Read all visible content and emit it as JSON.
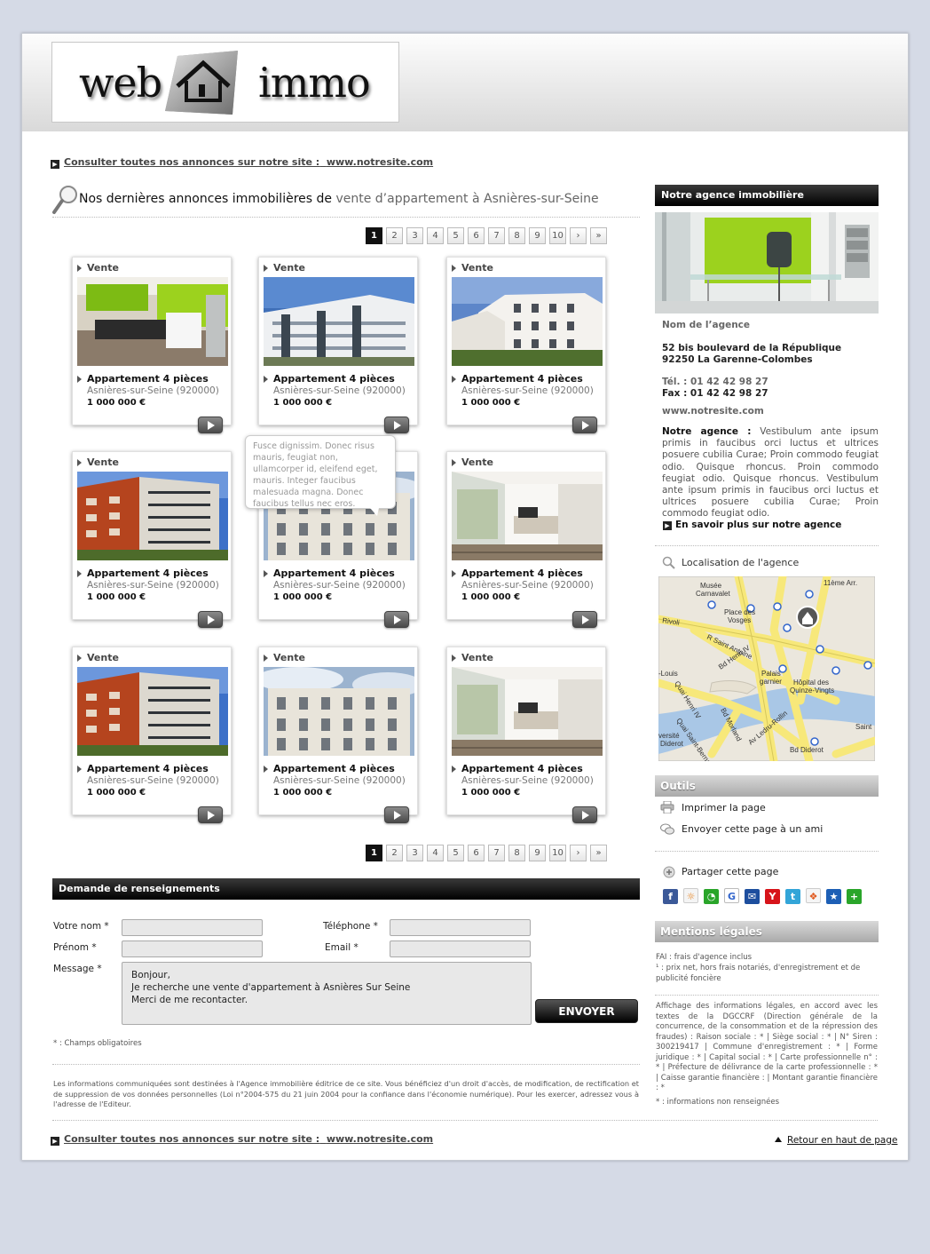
{
  "header": {
    "logo_left": "web",
    "logo_right": "immo"
  },
  "top_link": {
    "label": "Consulter toutes nos annonces sur notre site :",
    "url_text": "www.notresite.com"
  },
  "main": {
    "title_prefix": "Nos dernières annonces immobilières de",
    "title_accent": "vente d’appartement à Asnières-sur-Seine"
  },
  "pager": {
    "pages": [
      "1",
      "2",
      "3",
      "4",
      "5",
      "6",
      "7",
      "8",
      "9",
      "10"
    ],
    "next": "›",
    "last": "»",
    "active": "1"
  },
  "listings": [
    {
      "type": "Vente",
      "title": "Appartement 4 pièces",
      "location": "Asnières-sur-Seine (920000)",
      "price": "1 000 000 €",
      "photo": "kitchen"
    },
    {
      "type": "Vente",
      "title": "Appartement 4 pièces",
      "location": "Asnières-sur-Seine (920000)",
      "price": "1 000 000 €",
      "photo": "modern-building"
    },
    {
      "type": "Vente",
      "title": "Appartement 4 pièces",
      "location": "Asnières-sur-Seine (920000)",
      "price": "1 000 000 €",
      "photo": "white-building"
    },
    {
      "type": "Vente",
      "title": "Appartement 4 pièces",
      "location": "Asnières-sur-Seine (920000)",
      "price": "1 000 000 €",
      "photo": "brick-building"
    },
    {
      "type": "Vente",
      "title": "Appartement 4 pièces",
      "location": "Asnières-sur-Seine (920000)",
      "price": "1 000 000 €",
      "photo": "haussmann"
    },
    {
      "type": "Vente",
      "title": "Appartement 4 pièces",
      "location": "Asnières-sur-Seine (920000)",
      "price": "1 000 000 €",
      "photo": "living-room"
    },
    {
      "type": "Vente",
      "title": "Appartement 4 pièces",
      "location": "Asnières-sur-Seine (920000)",
      "price": "1 000 000 €",
      "photo": "brick-building"
    },
    {
      "type": "Vente",
      "title": "Appartement 4 pièces",
      "location": "Asnières-sur-Seine (920000)",
      "price": "1 000 000 €",
      "photo": "haussmann"
    },
    {
      "type": "Vente",
      "title": "Appartement 4 pièces",
      "location": "Asnières-sur-Seine (920000)",
      "price": "1 000 000 €",
      "photo": "living-room"
    }
  ],
  "tooltip": "Fusce dignissim. Donec risus mauris, feugiat non, ullamcorper id, eleifend eget, mauris. Integer faucibus malesuada magna. Donec faucibus tellus nec eros.",
  "form": {
    "title": "Demande de renseignements",
    "nom_label": "Votre nom  *",
    "prenom_label": "Prénom  *",
    "message_label": "Message *",
    "tel_label": "Téléphone  *",
    "email_label": "Email  *",
    "message_value": "Bonjour,\nJe recherche une vente d'appartement à Asnières Sur Seine\nMerci de me recontacter.",
    "send_label": "ENVOYER",
    "required_note": "* : Champs obligatoires",
    "privacy": "Les informations communiquées sont destinées à l'Agence immobilière éditrice de ce site. Vous bénéficiez d'un droit d'accès, de modification, de rectification et de suppression de vos données personnelles (Loi n°2004-575 du 21 juin 2004 pour la confiance dans l'économie numérique). Pour les exercer, adressez vous à l'adresse de l'Editeur."
  },
  "agency": {
    "title": "Notre agence immobilière",
    "name": "Nom de l’agence",
    "address1": "52 bis boulevard de la République",
    "address2": "92250 La Garenne-Colombes",
    "tel": "Tél. : 01 42 42 98 27",
    "fax": "Fax : 01 42 42 98 27",
    "website": "www.notresite.com",
    "desc_label": "Notre agence :",
    "desc": "Vestibulum ante ipsum primis in faucibus orci luctus et ultrices posuere cubilia Curae; Proin commodo feugiat odio. Quisque rhoncus. Proin commodo feugiat odio. Quisque rhoncus. Vestibulum ante ipsum primis in faucibus orci luctus et ultrices posuere cubilia Curae; Proin commodo feugiat odio.",
    "more_link": "En savoir plus sur notre agence",
    "map_title": "Localisation de l'agence",
    "map_labels": [
      "Musée Carnavalet",
      "Place des Vosges",
      "11ème Arr.",
      "Rivoli",
      "R Saint Antoine",
      "Bd Henri IV",
      "Quai Henri IV",
      "Bd Morland",
      "Palais garnier",
      "Hôpital des Quinze-Vingts",
      "Av Ledru-Rollin",
      "Quai Saint-Bernard",
      "Bd Diderot",
      "Saint-Louis",
      "versité Diderot",
      "Saint"
    ]
  },
  "tools": {
    "title": "Outils",
    "print": "Imprimer la page",
    "send": "Envoyer cette page à un ami",
    "share": "Partager cette page",
    "share_icons": [
      "facebook-icon",
      "blogger-icon",
      "whatsapp-icon",
      "google-icon",
      "myspace-icon",
      "yahoo-icon",
      "twitter-icon",
      "windows-live-icon",
      "favorites-icon",
      "more-icon"
    ]
  },
  "legal": {
    "title": "Mentions légales",
    "fai": "FAI : frais d'agence inclus",
    "prix": "¹ : prix net, hors frais notariés, d'enregistrement et de publicité foncière",
    "affichage": "Affichage des informations légales, en accord avec les textes de la DGCCRF (Direction générale de la concurrence, de la consommation et de la répression des fraudes) : Raison sociale : * | Siège social : * | N° Siren : 300219417 | Commune d'enregistrement : * | Forme juridique : * | Capital social : * | Carte professionnelle n° : * | Préfecture de délivrance de la carte professionnelle : * | Caisse garantie financière : | Montant garantie financière : *",
    "note": "* : informations non renseignées"
  },
  "footer": {
    "back_to_top": "Retour en haut de page"
  },
  "colors": {
    "accent_green": "#9cd21e",
    "map_road": "#f7e87a"
  }
}
